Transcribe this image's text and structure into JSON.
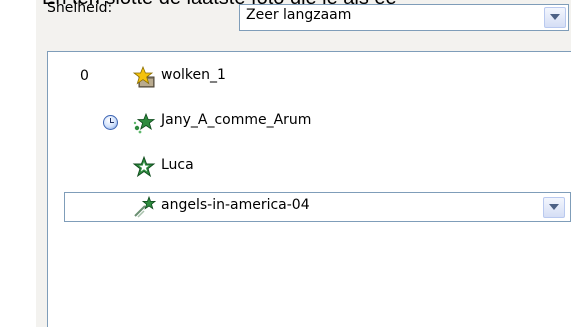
{
  "instruction_text": "En ten slotte de laatste foto die je als ee",
  "speed": {
    "label": "Snelheid:",
    "value": "Zeer langzaam"
  },
  "list": {
    "rows": [
      {
        "number": "0",
        "label": "wolken_1",
        "icon": "folder-star-icon"
      },
      {
        "number": "",
        "label": "Jany_A_comme_Arum",
        "icon": "sparkle-star-icon",
        "status_icon": "clock-icon"
      },
      {
        "number": "",
        "label": "Luca",
        "icon": "green-star-icon"
      },
      {
        "number": "",
        "label": "angels-in-america-04",
        "icon": "shooting-star-icon",
        "selected": true
      }
    ]
  },
  "colors": {
    "panel": "#f3f2ef",
    "border": "#7f9db9",
    "star_green": "#2e8b3e",
    "star_yellow": "#f4c20d"
  }
}
